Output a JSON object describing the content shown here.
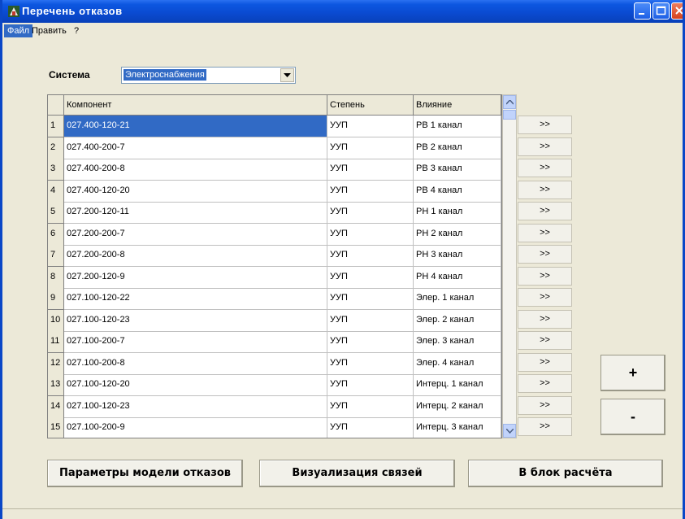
{
  "window": {
    "title": "Перечень отказов"
  },
  "menu": [
    "Файл",
    "Править",
    "?"
  ],
  "system": {
    "label": "Система",
    "value": "Электроснабжения"
  },
  "table": {
    "columns": [
      "Компонент",
      "Степень",
      "Влияние"
    ],
    "rows": [
      {
        "n": "1",
        "component": "027.400-120-21",
        "degree": "УУП",
        "effect": "РВ 1 канал"
      },
      {
        "n": "2",
        "component": "027.400-200-7",
        "degree": "УУП",
        "effect": "РВ 2 канал"
      },
      {
        "n": "3",
        "component": "027.400-200-8",
        "degree": "УУП",
        "effect": "РВ 3 канал"
      },
      {
        "n": "4",
        "component": "027.400-120-20",
        "degree": "УУП",
        "effect": "РВ 4 канал"
      },
      {
        "n": "5",
        "component": "027.200-120-11",
        "degree": "УУП",
        "effect": "РН 1 канал"
      },
      {
        "n": "6",
        "component": "027.200-200-7",
        "degree": "УУП",
        "effect": "РН 2 канал"
      },
      {
        "n": "7",
        "component": "027.200-200-8",
        "degree": "УУП",
        "effect": "РН 3 канал"
      },
      {
        "n": "8",
        "component": "027.200-120-9",
        "degree": "УУП",
        "effect": "РН 4 канал"
      },
      {
        "n": "9",
        "component": "027.100-120-22",
        "degree": "УУП",
        "effect": "Элер. 1 канал"
      },
      {
        "n": "10",
        "component": "027.100-120-23",
        "degree": "УУП",
        "effect": "Элер. 2 канал"
      },
      {
        "n": "11",
        "component": "027.100-200-7",
        "degree": "УУП",
        "effect": "Элер. 3 канал"
      },
      {
        "n": "12",
        "component": "027.100-200-8",
        "degree": "УУП",
        "effect": "Элер. 4 канал"
      },
      {
        "n": "13",
        "component": "027.100-120-20",
        "degree": "УУП",
        "effect": "Интерц. 1 канал"
      },
      {
        "n": "14",
        "component": "027.100-120-23",
        "degree": "УУП",
        "effect": "Интерц. 2 канал"
      },
      {
        "n": "15",
        "component": "027.100-200-9",
        "degree": "УУП",
        "effect": "Интерц. 3 канал"
      }
    ],
    "selected_row": 1
  },
  "row_button_label": ">>",
  "plus_label": "+",
  "minus_label": "-",
  "buttons": {
    "params": "Параметры модели отказов",
    "visual": "Визуализация связей",
    "calc": "В блок расчёта"
  },
  "colors": {
    "titlebar": "#0a4ad0",
    "selection": "#316ac5",
    "face": "#ece9d8"
  }
}
